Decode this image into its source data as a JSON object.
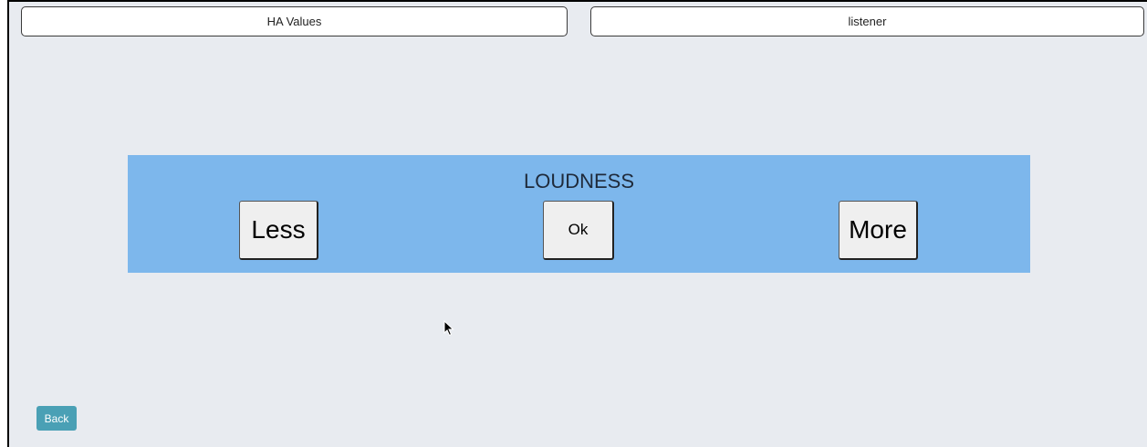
{
  "header": {
    "left_button_label": "HA Values",
    "right_button_label": "listener"
  },
  "loudness_panel": {
    "title": "LOUDNESS",
    "less_label": "Less",
    "ok_label": "Ok",
    "more_label": "More",
    "background_color": "#7db7ec"
  },
  "footer": {
    "back_label": "Back",
    "back_color": "#4aa0b5"
  },
  "icons": {
    "cursor": "mouse-pointer-icon"
  }
}
